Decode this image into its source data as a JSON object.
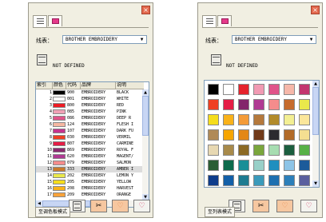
{
  "left_panel": {
    "close_glyph": "×",
    "thread_label": "线表：",
    "thread_value": "BROTHER EMBROIDERY",
    "dropdown_arrow": "▼",
    "not_defined": "NOT DEFINED",
    "columns": [
      "索引",
      "颜色",
      "代码",
      "品牌",
      "说明"
    ],
    "rows": [
      {
        "idx": "1",
        "code": "900",
        "brand": "EMBROIDERY",
        "desc": "BLACK",
        "color": "#000000"
      },
      {
        "idx": "2",
        "code": "001",
        "brand": "EMBROIDERY",
        "desc": "WHITE",
        "color": "#ffffff"
      },
      {
        "idx": "3",
        "code": "800",
        "brand": "EMBROIDERY",
        "desc": "RED",
        "color": "#ed1b24"
      },
      {
        "idx": "4",
        "code": "085",
        "brand": "EMBROIDERY",
        "desc": "PINK",
        "color": "#f0a1b5"
      },
      {
        "idx": "5",
        "code": "086",
        "brand": "EMBROIDERY",
        "desc": "DEEP R",
        "color": "#e0548a"
      },
      {
        "idx": "6",
        "code": "124",
        "brand": "EMBROIDERY",
        "desc": "FLESH I",
        "color": "#f5b7a1"
      },
      {
        "idx": "7",
        "code": "107",
        "brand": "EMBROIDERY",
        "desc": "DARK FU",
        "color": "#c6338e"
      },
      {
        "idx": "8",
        "code": "030",
        "brand": "EMBROIDERY",
        "desc": "VERMIL",
        "color": "#ef4023"
      },
      {
        "idx": "9",
        "code": "807",
        "brand": "EMBROIDERY",
        "desc": "CARMINE",
        "color": "#e51d46"
      },
      {
        "idx": "10",
        "code": "869",
        "brand": "EMBROIDERY",
        "desc": "ROYAL F",
        "color": "#8a2a6f"
      },
      {
        "idx": "11",
        "code": "620",
        "brand": "EMBROIDERY",
        "desc": "MAGENT/",
        "color": "#b03a93"
      },
      {
        "idx": "12",
        "code": "079",
        "brand": "EMBROIDERY",
        "desc": "SALMON",
        "color": "#f58c8c"
      },
      {
        "idx": "13",
        "code": "333",
        "brand": "EMBROIDERY",
        "desc": "AMBER I",
        "color": "#c97a2b"
      },
      {
        "idx": "14",
        "code": "202",
        "brand": "EMBROIDERY",
        "desc": "LEMON Y",
        "color": "#e9e84b"
      },
      {
        "idx": "15",
        "code": "205",
        "brand": "EMBROIDERY",
        "desc": "YELLOW",
        "color": "#f5dd1c"
      },
      {
        "idx": "16",
        "code": "208",
        "brand": "EMBROIDERY",
        "desc": "HARVEST",
        "color": "#f9b21a"
      },
      {
        "idx": "17",
        "code": "209",
        "brand": "EMBROIDERY",
        "desc": "ORANGE",
        "color": "#f7a23a"
      }
    ],
    "mode_button": "至调色板模式"
  },
  "right_panel": {
    "close_glyph": "×",
    "thread_label": "线表：",
    "thread_value": "BROTHER EMBROIDERY",
    "dropdown_arrow": "▼",
    "not_defined": "NOT DEFINED",
    "swatches": [
      "#000000",
      "#ffffff",
      "#e5232c",
      "#f19ab3",
      "#e0548a",
      "#f6b7a9",
      "#c3356f",
      "#ef4023",
      "#e51d46",
      "#83266b",
      "#b03a93",
      "#f58c8c",
      "#c66b2c",
      "#e9e84b",
      "#f5dd1c",
      "#f9b21a",
      "#f49b38",
      "#b5793c",
      "#b28b2a",
      "#f3ef93",
      "#fbe69a",
      "#b08a57",
      "#f6a500",
      "#e38716",
      "#713a19",
      "#2c2a2f",
      "#b26b29",
      "#f4df91",
      "#e7d8b2",
      "#a88a4a",
      "#8c6a24",
      "#7aa63c",
      "#a7ddb1",
      "#1b5e3f",
      "#58b147",
      "#2b5e34",
      "#0d6b4c",
      "#1a8f97",
      "#98d0c8",
      "#1f8fbf",
      "#8dc4e7",
      "#1c5b9a",
      "#0d3c8b",
      "#125fa8",
      "#1d7b91",
      "#3a9abb",
      "#1d6fb0",
      "#2c7fba",
      "#5a5f9e"
    ],
    "mode_button": "至列表模式"
  },
  "toolbar": {
    "spool_icon": "spool-icon",
    "scissors_icon": "scissors-icon",
    "heart_outline_icon": "heart-icon",
    "heart_icon": "heart-icon",
    "heart_glyph": "♡",
    "scissors_glyph": "✂"
  }
}
